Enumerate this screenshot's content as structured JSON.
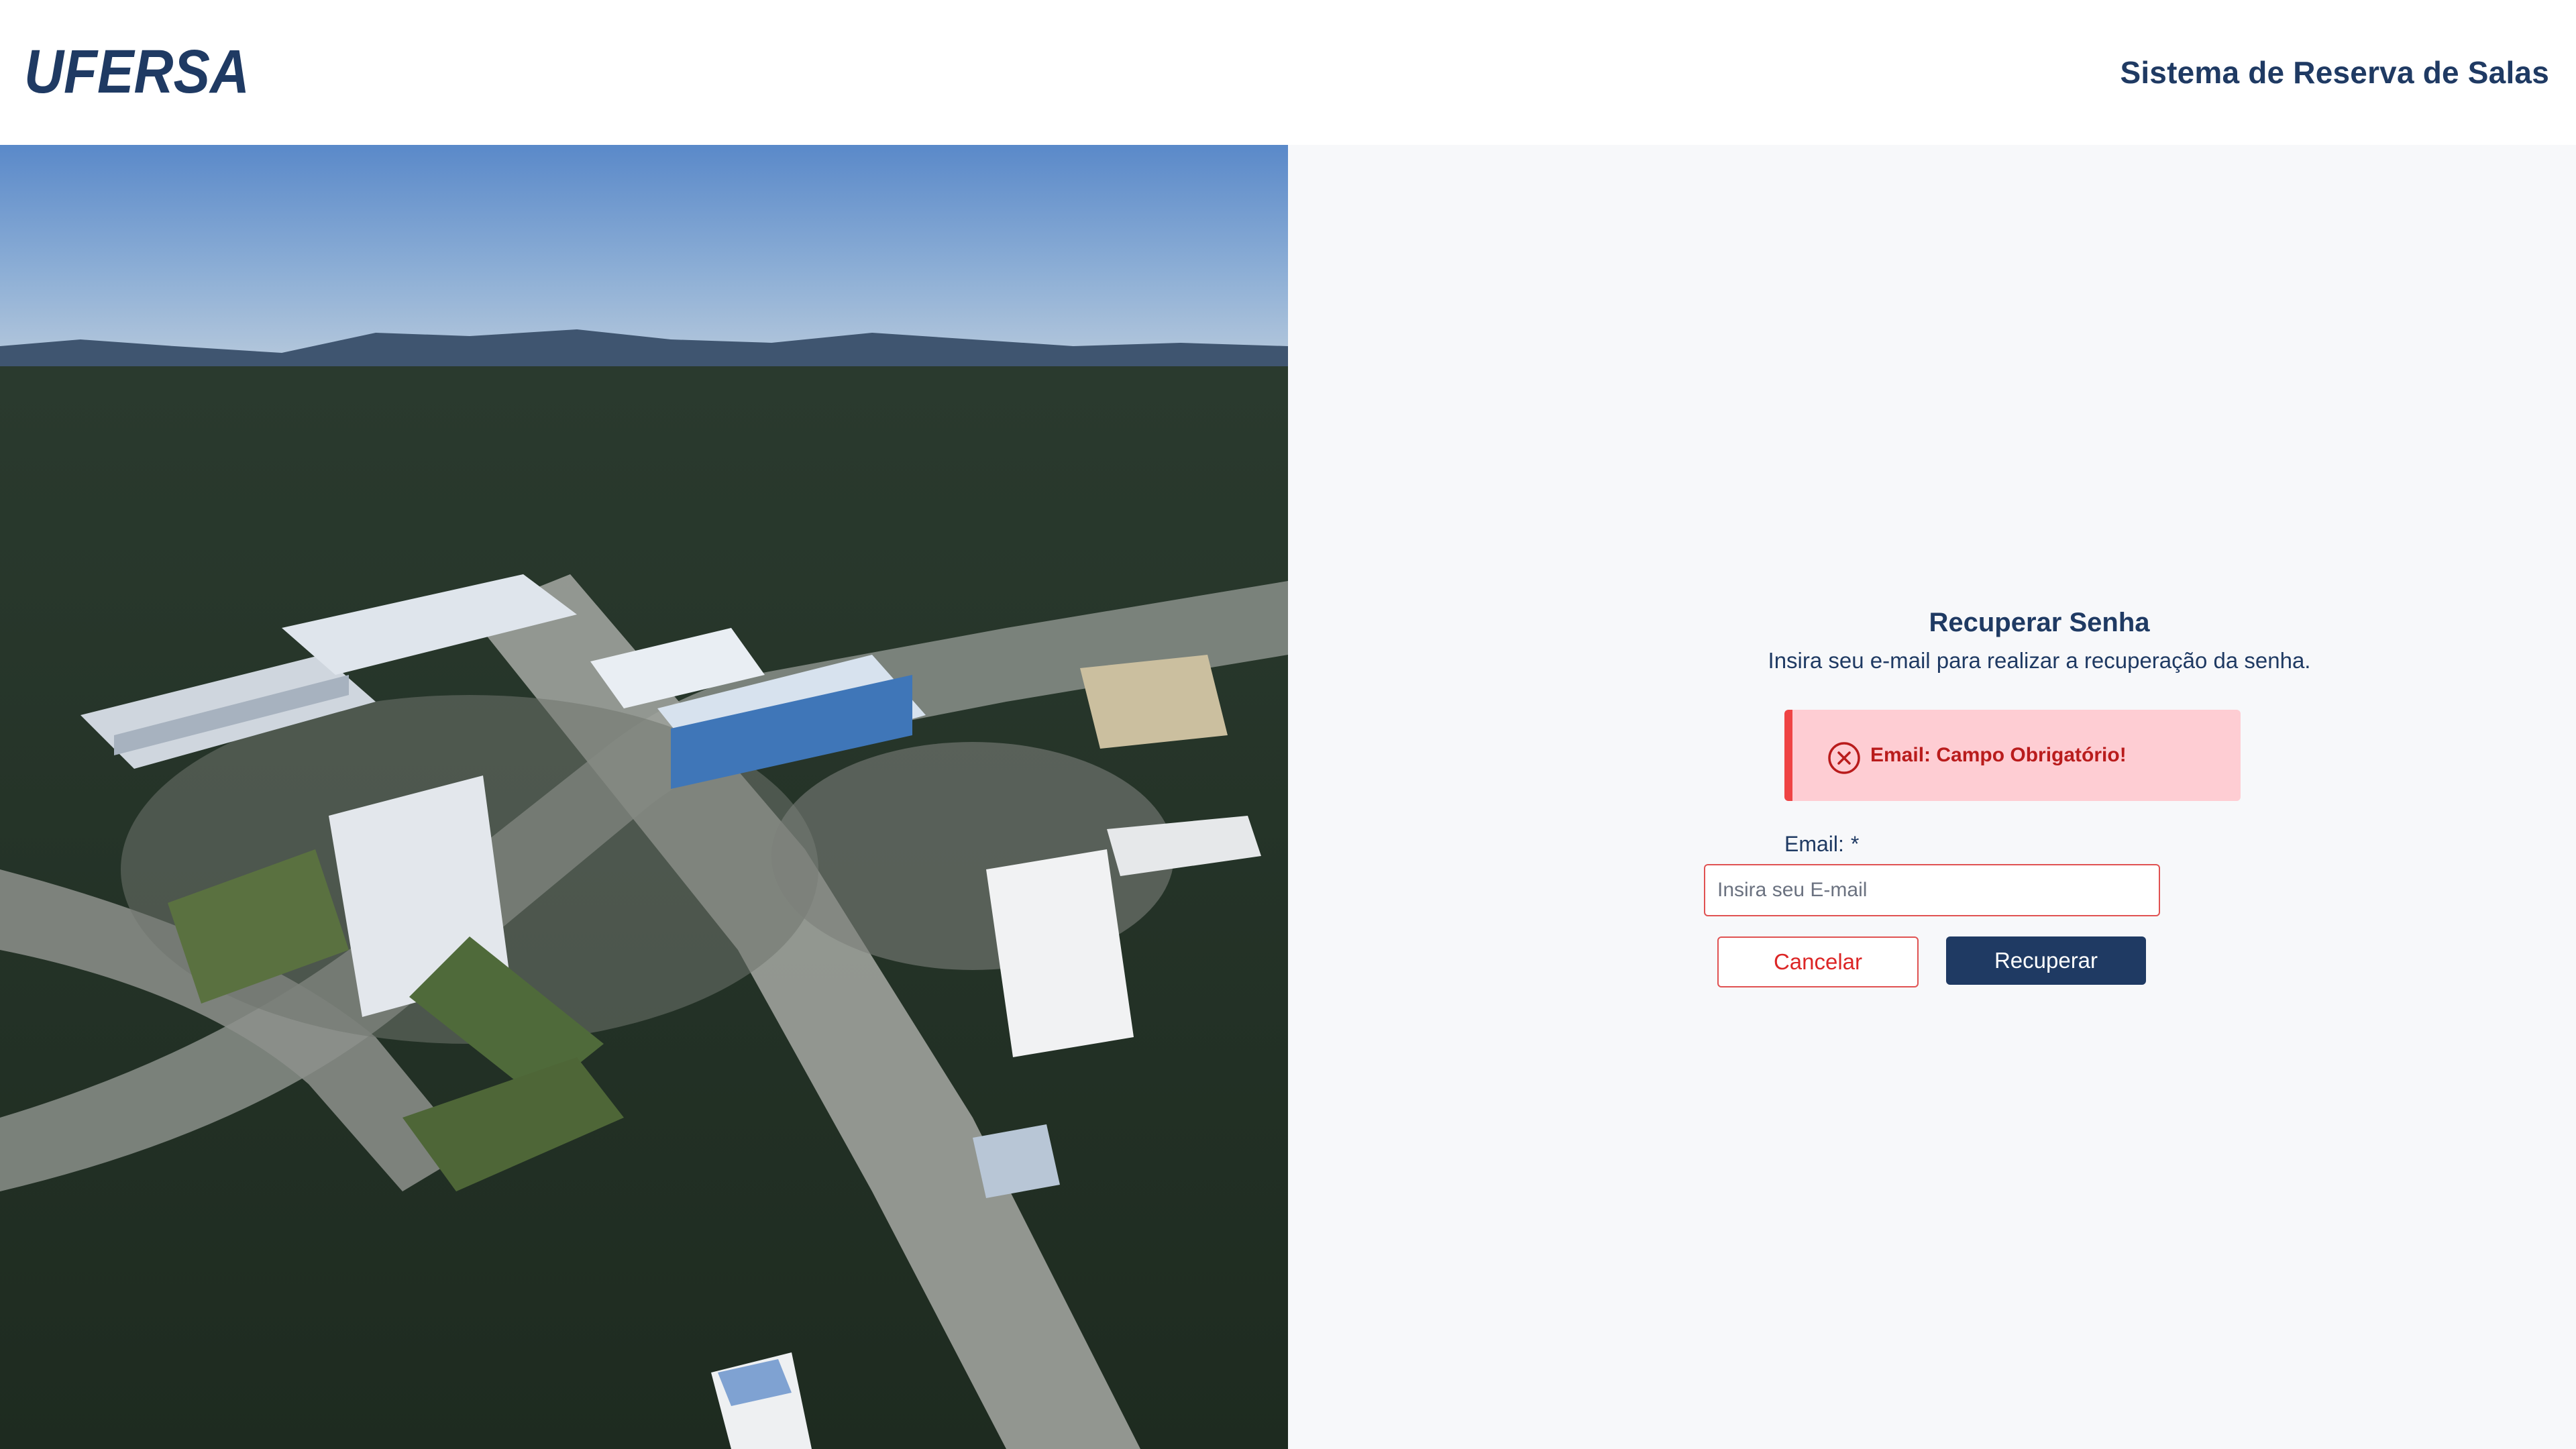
{
  "header": {
    "logo_text": "UFERSA",
    "app_title": "Sistema de Reserva de Salas"
  },
  "form": {
    "title": "Recuperar Senha",
    "subtitle": "Insira seu e-mail para realizar a recuperação da senha.",
    "alert": {
      "icon": "x-circle-icon",
      "message": "Email: Campo Obrigatório!"
    },
    "email": {
      "label": "Email:",
      "required_marker": "*",
      "value": "",
      "placeholder": "Insira seu E-mail"
    },
    "buttons": {
      "cancel": "Cancelar",
      "recover": "Recuperar"
    }
  },
  "colors": {
    "brand_navy": "#1f3a63",
    "error_red": "#ef4444",
    "error_bg": "#fecdd3",
    "error_text": "#b91c1c",
    "page_bg": "#f7f8fa"
  }
}
